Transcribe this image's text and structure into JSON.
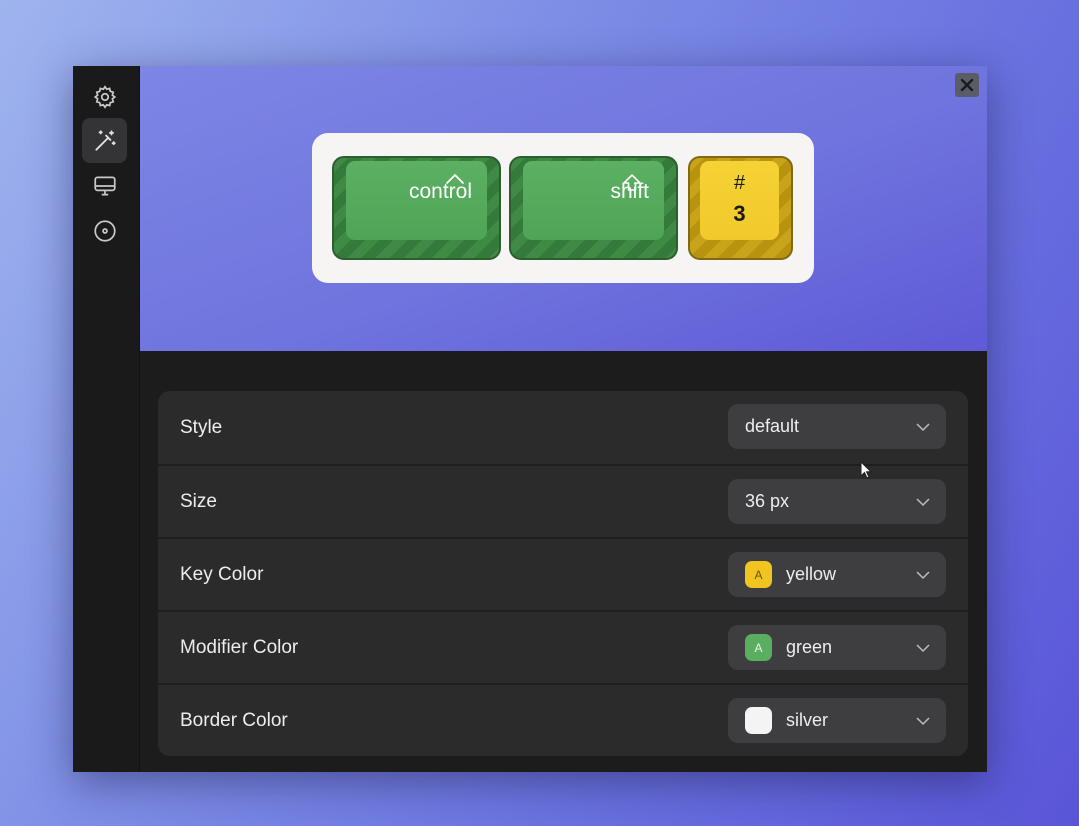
{
  "sidebar": {
    "items": [
      {
        "icon": "gear-icon"
      },
      {
        "icon": "magic-wand-icon",
        "active": true
      },
      {
        "icon": "monitor-icon"
      },
      {
        "icon": "disc-icon"
      }
    ]
  },
  "preview": {
    "keys": [
      {
        "label": "control",
        "symbol": "^",
        "color": "green"
      },
      {
        "label": "shift",
        "symbol": "⇧",
        "color": "green"
      },
      {
        "symbol_top": "#",
        "symbol_bottom": "3",
        "color": "yellow"
      }
    ]
  },
  "settings": {
    "rows": [
      {
        "label": "Style",
        "value": "default"
      },
      {
        "label": "Size",
        "value": "36 px"
      },
      {
        "label": "Key Color",
        "value": "yellow",
        "swatch_text": "A",
        "swatch_color": "#f2c41f"
      },
      {
        "label": "Modifier Color",
        "value": "green",
        "swatch_text": "A",
        "swatch_color": "#5aae5f"
      },
      {
        "label": "Border Color",
        "value": "silver",
        "swatch_color": "#f4f4f4"
      }
    ]
  }
}
